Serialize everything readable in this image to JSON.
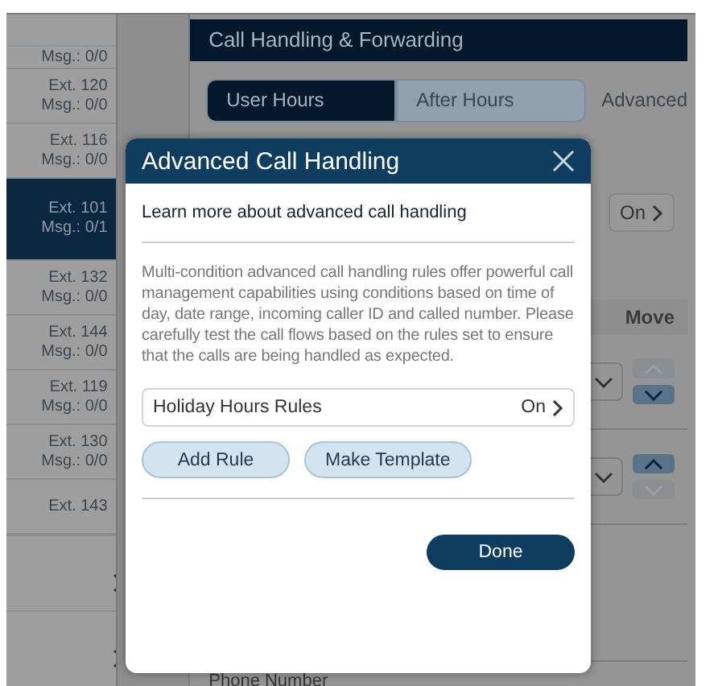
{
  "sidebar": {
    "items": [
      {
        "msg": "Msg.: 0/0",
        "selected": false
      },
      {
        "ext": "Ext. 120",
        "msg": "Msg.: 0/0",
        "selected": false
      },
      {
        "ext": "Ext. 116",
        "msg": "Msg.: 0/0",
        "selected": false
      },
      {
        "ext": "Ext. 101",
        "msg": "Msg.: 0/1",
        "selected": true
      },
      {
        "ext": "Ext. 132",
        "msg": "Msg.: 0/0",
        "selected": false
      },
      {
        "ext": "Ext. 144",
        "msg": "Msg.: 0/0",
        "selected": false
      },
      {
        "ext": "Ext. 119",
        "msg": "Msg.: 0/0",
        "selected": false
      },
      {
        "ext": "Ext. 130",
        "msg": "Msg.: 0/0",
        "selected": false
      },
      {
        "ext": "Ext. 143",
        "selected": false
      }
    ]
  },
  "panel": {
    "title": "Call Handling & Forwarding",
    "tabs": [
      {
        "label": "User Hours",
        "selected": true
      },
      {
        "label": "After Hours",
        "selected": false
      },
      {
        "label": "Advanced",
        "selected": false
      }
    ],
    "status_value": "On",
    "move_header": "Move",
    "rules": [
      {
        "up_enabled": false,
        "down_enabled": true
      },
      {
        "up_enabled": true,
        "down_enabled": false
      }
    ],
    "phone_label": "Phone Number"
  },
  "dialog": {
    "title": "Advanced Call Handling",
    "link": "Learn more about advanced call handling",
    "description": "Multi-condition advanced call handling rules offer powerful call management capabilities using conditions based on time of day, date range, incoming caller ID and called number. Please carefully test the call flows based on the rules set to ensure that the calls are being handled as expected.",
    "rule_row": {
      "label": "Holiday Hours Rules",
      "value": "On"
    },
    "buttons": [
      {
        "label": "Add Rule",
        "kind": "secondary"
      },
      {
        "label": "Make Template",
        "kind": "secondary"
      }
    ],
    "done": {
      "label": "Done",
      "kind": "primary"
    }
  }
}
